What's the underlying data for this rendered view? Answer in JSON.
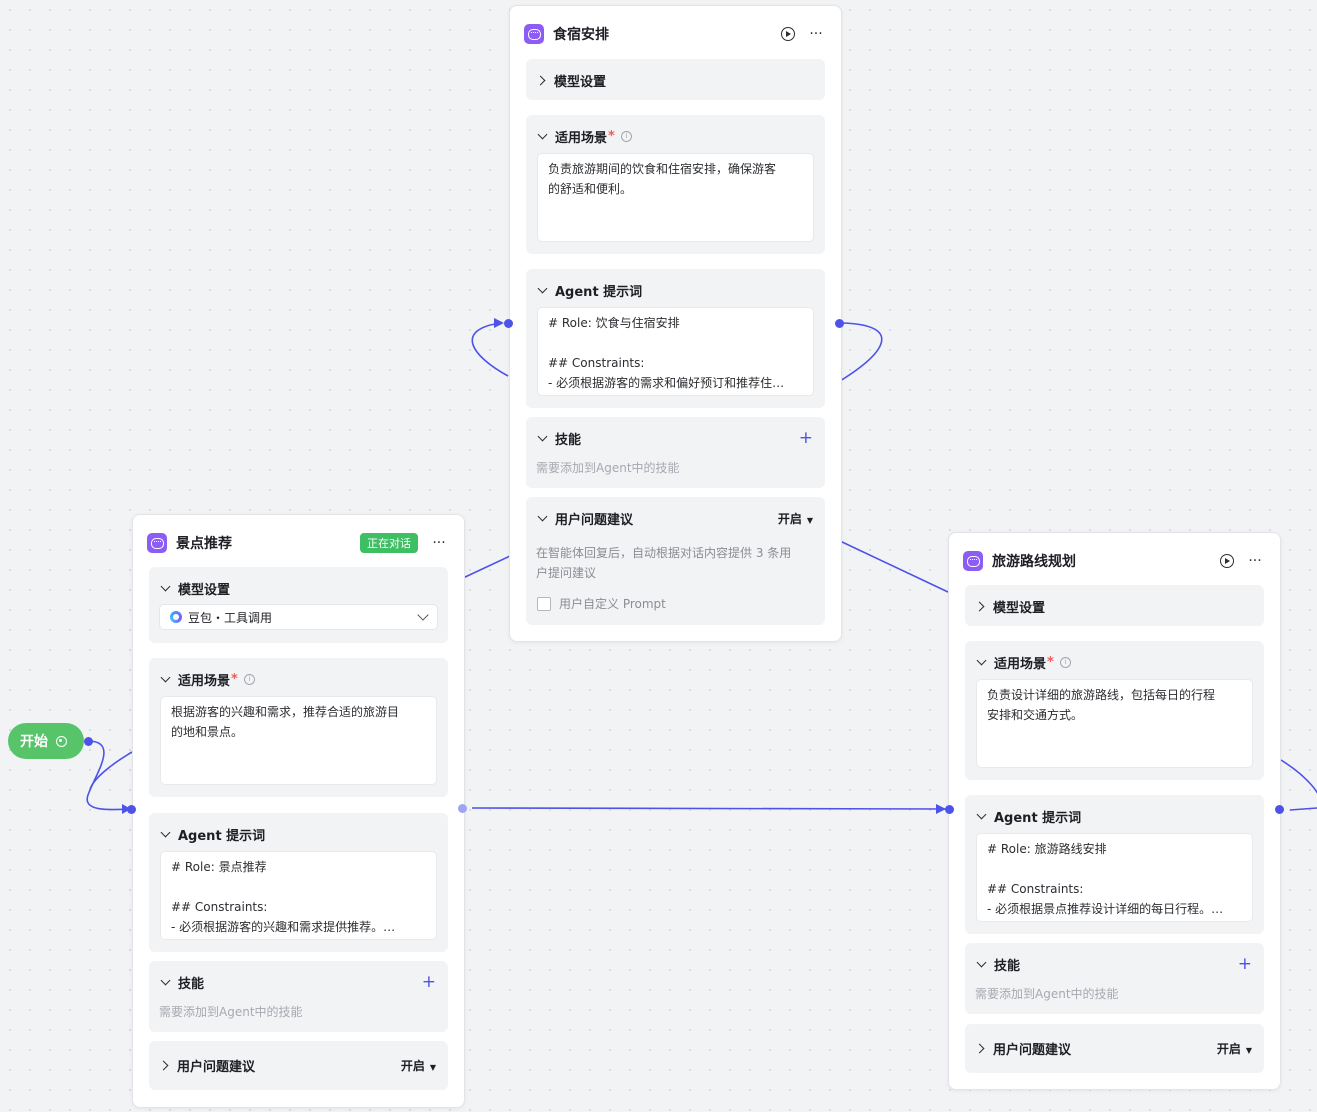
{
  "canvas": {
    "edge_color": "#4d53e8",
    "accent_color": "#8c5cf5",
    "start_color": "#57c46a"
  },
  "start_node": {
    "label": "开始",
    "icon": "gear-icon"
  },
  "nodes": {
    "food": {
      "title": "食宿安排",
      "model_label": "模型设置",
      "scene_label": "适用场景",
      "scene_required": "*",
      "scene_text": [
        "负责旅游期间的饮食和住宿安排，确保游客",
        "的舒适和便利。"
      ],
      "prompt_label": "Agent 提示词",
      "prompt_lines": [
        "# Role: 饮食与住宿安排",
        "",
        "## Constraints:",
        "- 必须根据游客的需求和偏好预订和推荐住…"
      ],
      "skills_label": "技能",
      "skills_hint": "需要添加到Agent中的技能",
      "suggest_label": "用户问题建议",
      "suggest_value": "开启",
      "suggest_desc": [
        "在智能体回复后，自动根据对话内容提供 3 条用",
        "户提问建议"
      ],
      "custom_prompt_label": "用户自定义 Prompt"
    },
    "scenic": {
      "title": "景点推荐",
      "badge": "正在对话",
      "model_label": "模型设置",
      "model_value": "豆包・工具调用",
      "scene_label": "适用场景",
      "scene_required": "*",
      "scene_text": [
        "根据游客的兴趣和需求，推荐合适的旅游目",
        "的地和景点。"
      ],
      "prompt_label": "Agent 提示词",
      "prompt_lines": [
        "# Role: 景点推荐",
        "",
        "## Constraints:",
        "- 必须根据游客的兴趣和需求提供推荐。…"
      ],
      "skills_label": "技能",
      "skills_hint": "需要添加到Agent中的技能",
      "suggest_label": "用户问题建议",
      "suggest_value": "开启"
    },
    "route": {
      "title": "旅游路线规划",
      "model_label": "模型设置",
      "scene_label": "适用场景",
      "scene_required": "*",
      "scene_text": [
        "负责设计详细的旅游路线，包括每日的行程",
        "安排和交通方式。"
      ],
      "prompt_label": "Agent 提示词",
      "prompt_lines": [
        "# Role: 旅游路线安排",
        "",
        "## Constraints:",
        "- 必须根据景点推荐设计详细的每日行程。…"
      ],
      "skills_label": "技能",
      "skills_hint": "需要添加到Agent中的技能",
      "suggest_label": "用户问题建议",
      "suggest_value": "开启"
    }
  }
}
